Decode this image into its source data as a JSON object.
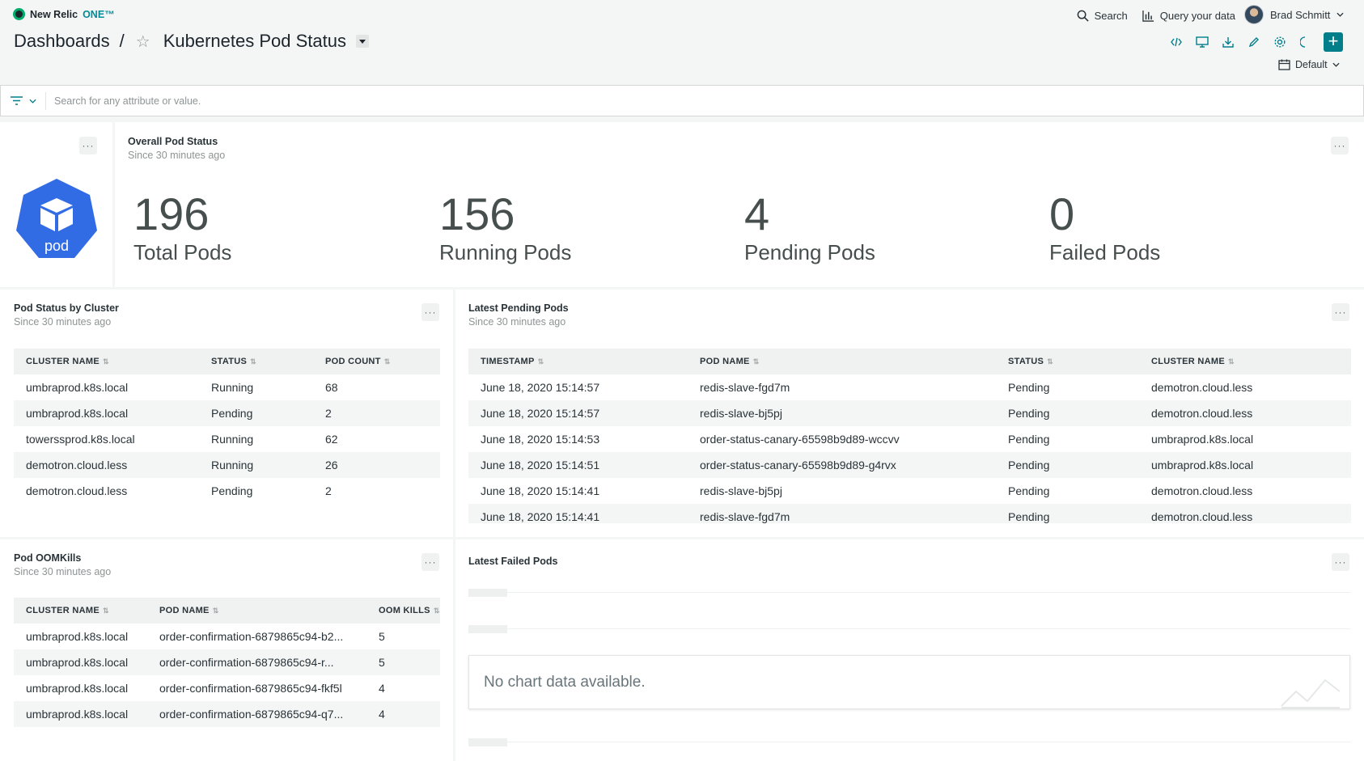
{
  "app": {
    "brand": "New Relic",
    "brand_suffix": "ONE™"
  },
  "topnav": {
    "search_label": "Search",
    "query_label": "Query your data",
    "user_name": "Brad Schmitt"
  },
  "breadcrumb": {
    "root": "Dashboards",
    "separator": "/",
    "title": "Kubernetes Pod Status"
  },
  "timepicker": {
    "label": "Default"
  },
  "filter": {
    "placeholder": "Search for any attribute or value."
  },
  "overview": {
    "logo_label": "pod",
    "title": "Overall Pod Status",
    "subtitle": "Since 30 minutes ago",
    "stats": [
      {
        "value": "196",
        "label": "Total Pods"
      },
      {
        "value": "156",
        "label": "Running Pods"
      },
      {
        "value": "4",
        "label": "Pending Pods"
      },
      {
        "value": "0",
        "label": "Failed Pods"
      }
    ]
  },
  "cluster_status": {
    "title": "Pod Status by Cluster",
    "subtitle": "Since 30 minutes ago",
    "columns": [
      "CLUSTER NAME",
      "STATUS",
      "POD COUNT"
    ],
    "rows": [
      [
        "umbraprod.k8s.local",
        "Running",
        "68"
      ],
      [
        "umbraprod.k8s.local",
        "Pending",
        "2"
      ],
      [
        "towerssprod.k8s.local",
        "Running",
        "62"
      ],
      [
        "demotron.cloud.less",
        "Running",
        "26"
      ],
      [
        "demotron.cloud.less",
        "Pending",
        "2"
      ]
    ]
  },
  "pending_pods": {
    "title": "Latest Pending Pods",
    "subtitle": "Since 30 minutes ago",
    "columns": [
      "TIMESTAMP",
      "POD NAME",
      "STATUS",
      "CLUSTER NAME"
    ],
    "rows": [
      [
        "June 18, 2020 15:14:57",
        "redis-slave-fgd7m",
        "Pending",
        "demotron.cloud.less"
      ],
      [
        "June 18, 2020 15:14:57",
        "redis-slave-bj5pj",
        "Pending",
        "demotron.cloud.less"
      ],
      [
        "June 18, 2020 15:14:53",
        "order-status-canary-65598b9d89-wccvv",
        "Pending",
        "umbraprod.k8s.local"
      ],
      [
        "June 18, 2020 15:14:51",
        "order-status-canary-65598b9d89-g4rvx",
        "Pending",
        "umbraprod.k8s.local"
      ],
      [
        "June 18, 2020 15:14:41",
        "redis-slave-bj5pj",
        "Pending",
        "demotron.cloud.less"
      ],
      [
        "June 18, 2020 15:14:41",
        "redis-slave-fgd7m",
        "Pending",
        "demotron.cloud.less"
      ]
    ]
  },
  "oom_kills": {
    "title": "Pod OOMKills",
    "subtitle": "Since 30 minutes ago",
    "columns": [
      "CLUSTER NAME",
      "POD NAME",
      "OOM KILLS"
    ],
    "rows": [
      [
        "umbraprod.k8s.local",
        "order-confirmation-6879865c94-b2...",
        "5"
      ],
      [
        "umbraprod.k8s.local",
        "order-confirmation-6879865c94-r...",
        "5"
      ],
      [
        "umbraprod.k8s.local",
        "order-confirmation-6879865c94-fkf5l",
        "4"
      ],
      [
        "umbraprod.k8s.local",
        "order-confirmation-6879865c94-q7...",
        "4"
      ]
    ]
  },
  "failed_pods": {
    "title": "Latest Failed Pods",
    "empty_message": "No chart data available."
  },
  "colors": {
    "accent": "#007e8a",
    "brand_green": "#00ac69",
    "pod_logo": "#326ce5"
  }
}
